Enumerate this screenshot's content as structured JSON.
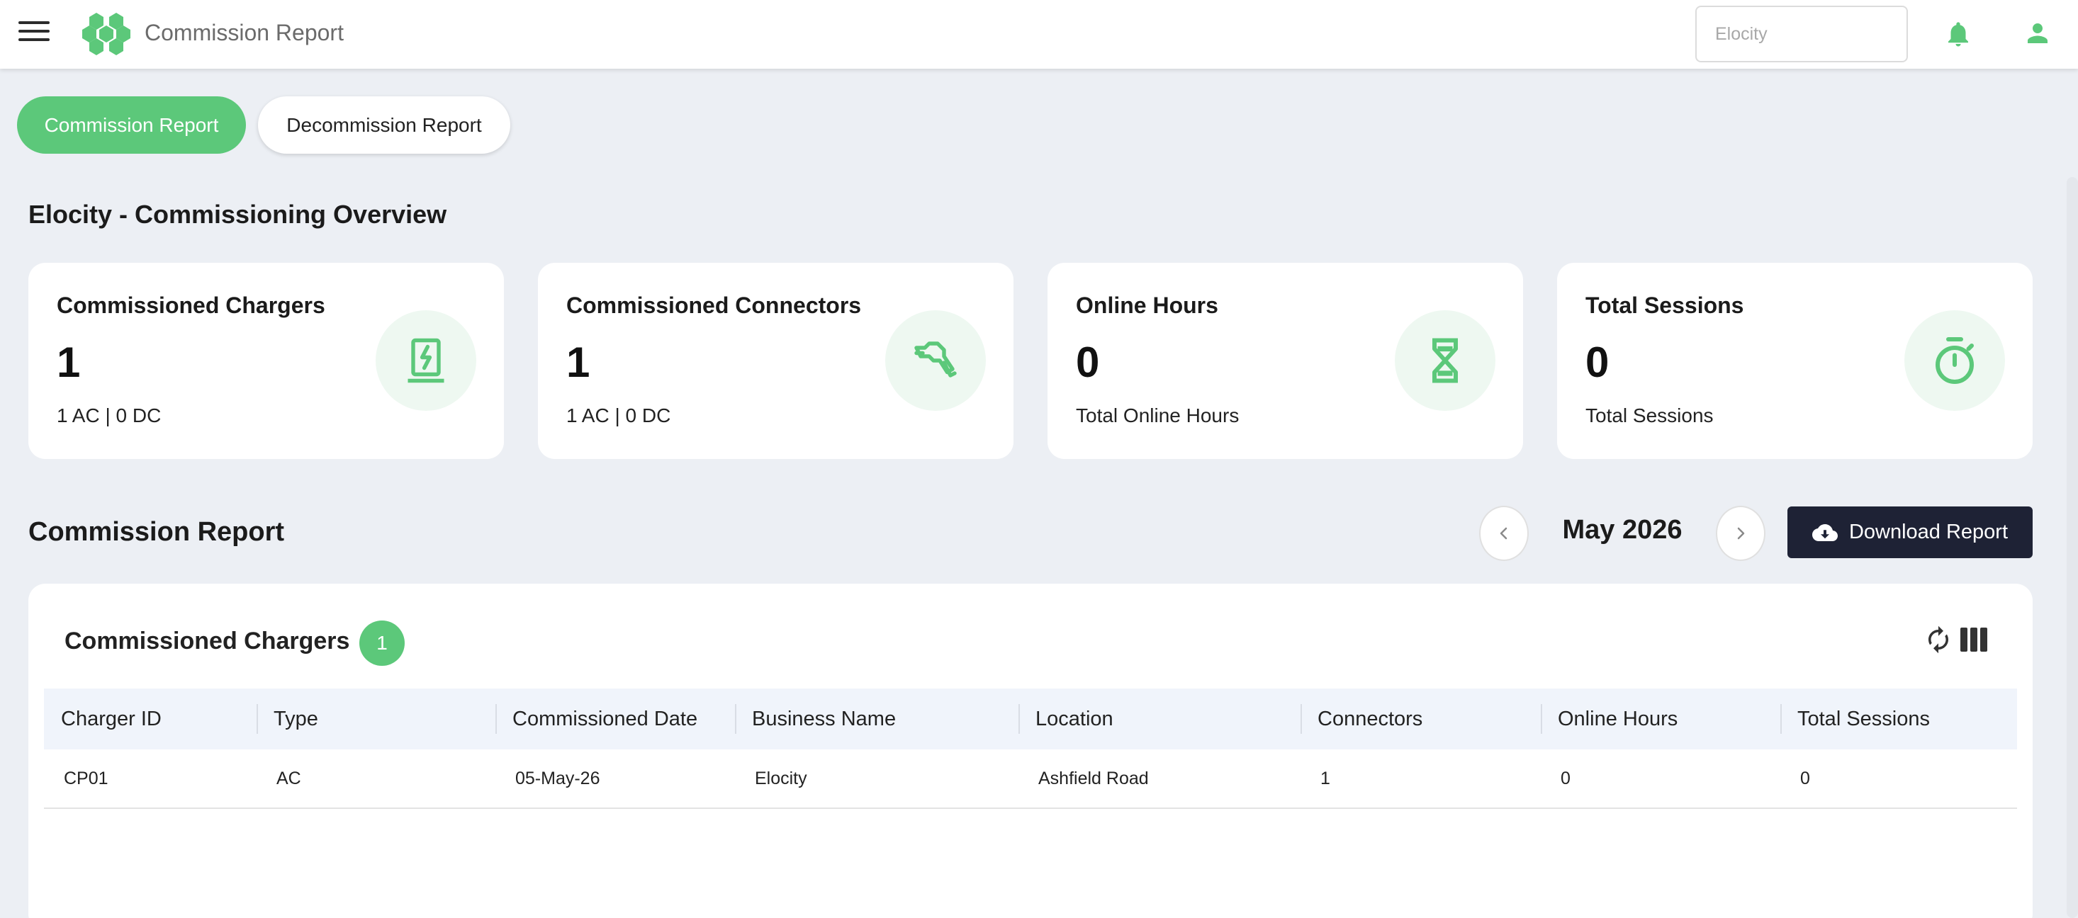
{
  "header": {
    "title": "Commission Report",
    "org_placeholder": "Elocity"
  },
  "tabs": [
    {
      "label": "Commission Report",
      "active": true
    },
    {
      "label": "Decommission Report",
      "active": false
    }
  ],
  "overview": {
    "title": "Elocity - Commissioning Overview",
    "cards": [
      {
        "title": "Commissioned Chargers",
        "value": "1",
        "sub": "1 AC | 0 DC",
        "icon": "charger-icon"
      },
      {
        "title": "Commissioned Connectors",
        "value": "1",
        "sub": "1 AC | 0 DC",
        "icon": "connector-plug-icon"
      },
      {
        "title": "Online Hours",
        "value": "0",
        "sub": "Total Online Hours",
        "icon": "hourglass-icon"
      },
      {
        "title": "Total Sessions",
        "value": "0",
        "sub": "Total Sessions",
        "icon": "stopwatch-icon"
      }
    ]
  },
  "report": {
    "title": "Commission Report",
    "period": "May 2026",
    "download_label": "Download Report"
  },
  "table": {
    "title": "Commissioned Chargers",
    "count": "1",
    "columns": [
      "Charger ID",
      "Type",
      "Commissioned Date",
      "Business Name",
      "Location",
      "Connectors",
      "Online Hours",
      "Total Sessions"
    ],
    "rows": [
      [
        "CP01",
        "AC",
        "05-May-26",
        "Elocity",
        "Ashfield Road",
        "1",
        "0",
        "0"
      ]
    ]
  },
  "colors": {
    "accent": "#5cc87a",
    "dark_button": "#1e2235",
    "background": "#eceff4"
  }
}
